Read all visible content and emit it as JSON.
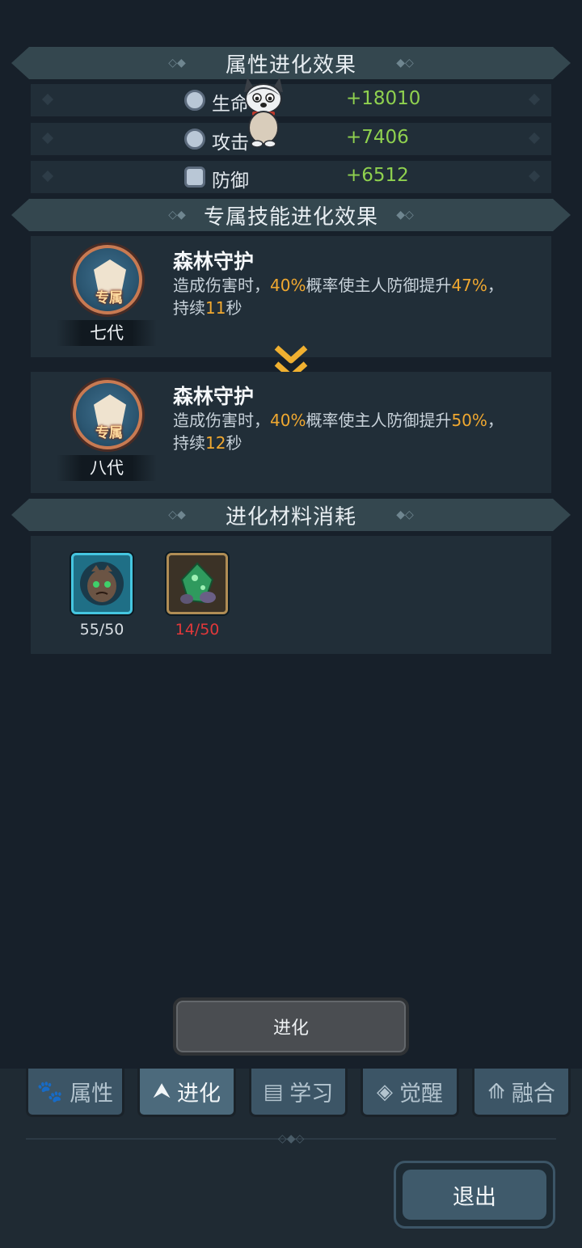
{
  "sections": {
    "attributes_title": "属性进化效果",
    "skill_title": "专属技能进化效果",
    "materials_title": "进化材料消耗"
  },
  "stats": [
    {
      "name": "生命",
      "value": "+18010",
      "icon": "heart-icon"
    },
    {
      "name": "攻击",
      "value": "+7406",
      "icon": "heart-icon"
    },
    {
      "name": "防御",
      "value": "+6512",
      "icon": "shield-icon"
    }
  ],
  "skills": [
    {
      "generation": "七代",
      "tag": "专属",
      "name": "森林守护",
      "desc_prefix": "造成伤害时，",
      "chance": "40%",
      "desc_mid": "概率使主人防御提升",
      "boost": "47%",
      "desc_suffix": "，",
      "desc_prefix2": "持续",
      "duration": "11",
      "desc_unit": "秒"
    },
    {
      "generation": "八代",
      "tag": "专属",
      "name": "森林守护",
      "desc_prefix": "造成伤害时，",
      "chance": "40%",
      "desc_mid": "概率使主人防御提升",
      "boost": "50%",
      "desc_suffix": "，",
      "desc_prefix2": "持续",
      "duration": "12",
      "desc_unit": "秒"
    }
  ],
  "materials": [
    {
      "icon": "creature-portrait-icon",
      "count": "55/50",
      "count_color": "#d8dee3"
    },
    {
      "icon": "green-crystal-icon",
      "count": "14/50",
      "count_color": "#e0383a"
    }
  ],
  "actions": {
    "evolve_label": "进化",
    "exit_label": "退出"
  },
  "tabs": [
    {
      "label": "属性",
      "icon": "paw-icon",
      "active": false
    },
    {
      "label": "进化",
      "icon": "arrow-up-icon",
      "active": true
    },
    {
      "label": "学习",
      "icon": "book-icon",
      "active": false
    },
    {
      "label": "觉醒",
      "icon": "wolf-head-icon",
      "active": false
    },
    {
      "label": "融合",
      "icon": "merge-icon",
      "active": false
    }
  ],
  "colors": {
    "stat_value": "#8fd14f",
    "highlight": "#f0a830",
    "insufficient": "#e0383a"
  }
}
